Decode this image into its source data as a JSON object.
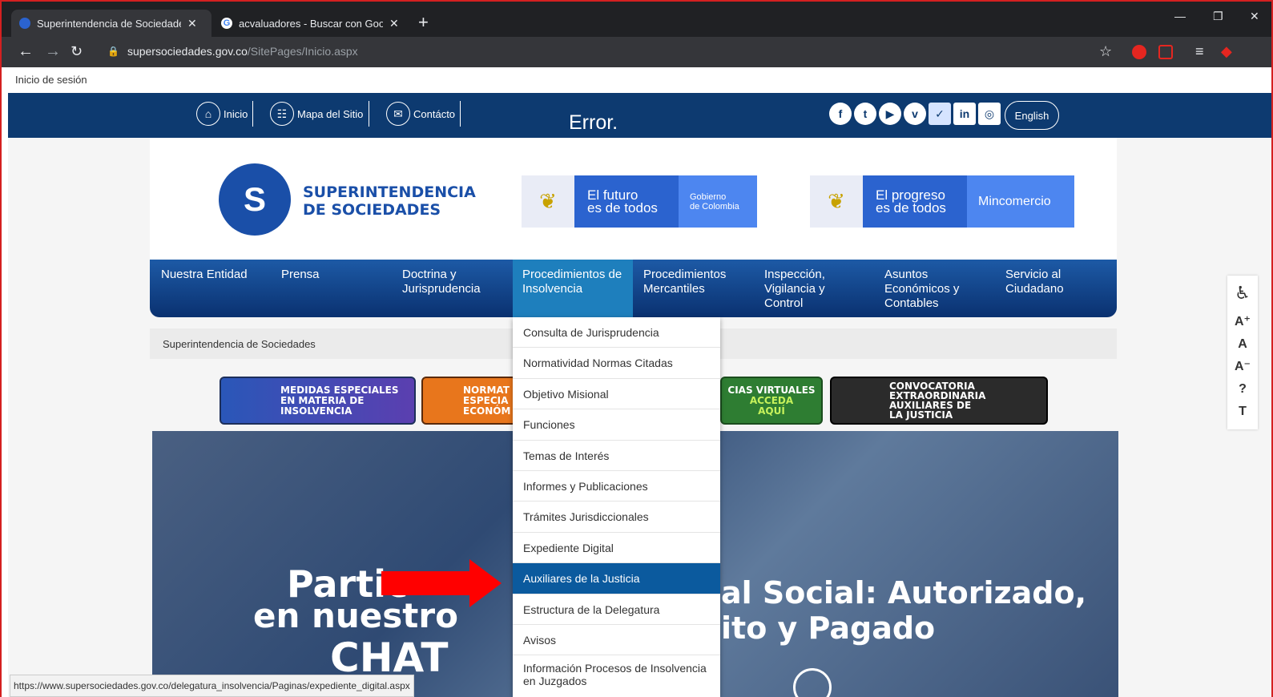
{
  "browser": {
    "tabs": [
      {
        "title": "Superintendencia de Sociedades"
      },
      {
        "title": "acvaluadores - Buscar con Googl"
      }
    ],
    "url_host": "supersociedades.gov.co",
    "url_path": "/SitePages/Inicio.aspx",
    "new_tab": "+",
    "close_glyph": "✕"
  },
  "page": {
    "login": "Inicio de sesión",
    "topnav": [
      {
        "label": "Inicio"
      },
      {
        "label": "Mapa del Sitio"
      },
      {
        "label": "Contácto"
      }
    ],
    "error": "Error.",
    "english": "English",
    "logo_line1": "SUPERINTENDENCIA",
    "logo_line2": "DE SOCIEDADES",
    "gov1": {
      "main1": "El futuro",
      "main2": "es de todos",
      "side1": "Gobierno",
      "side2": "de Colombia"
    },
    "gov2": {
      "main1": "El progreso",
      "main2": "es de todos",
      "side": "Mincomercio"
    },
    "menu": [
      {
        "l1": "Nuestra Entidad",
        "l2": "",
        "l3": ""
      },
      {
        "l1": "Prensa",
        "l2": "",
        "l3": ""
      },
      {
        "l1": "Doctrina y",
        "l2": "Jurisprudencia",
        "l3": ""
      },
      {
        "l1": "Procedimientos de",
        "l2": "Insolvencia",
        "l3": ""
      },
      {
        "l1": "Procedimientos",
        "l2": "Mercantiles",
        "l3": ""
      },
      {
        "l1": "Inspección,",
        "l2": "Vigilancia y",
        "l3": "Control"
      },
      {
        "l1": "Asuntos",
        "l2": "Económicos y",
        "l3": "Contables"
      },
      {
        "l1": "Servicio al",
        "l2": "Ciudadano",
        "l3": ""
      }
    ],
    "breadcrumb": "Superintendencia de Sociedades",
    "banners": {
      "b1": [
        "MEDIDAS ESPECIALES",
        "EN MATERIA DE",
        "INSOLVENCIA"
      ],
      "b2": [
        "NORMAT",
        "ESPECIA",
        "ECONÓM"
      ],
      "b3": [
        "CIAS VIRTUALES",
        "ACCEDA",
        "AQUÍ"
      ],
      "b4": [
        "CONVOCATORIA",
        "EXTRAORDINARIA",
        "AUXILIARES DE",
        "LA JUSTICIA"
      ]
    },
    "hero": {
      "left1": "Partic",
      "left2": "en nuestro",
      "left3": "CHAT",
      "right1": "al Social: Autorizado,",
      "right2": "ito y Pagado"
    },
    "dropdown": [
      "Consulta de Jurisprudencia",
      "Normatividad Normas Citadas",
      "Objetivo Misional",
      "Funciones",
      "Temas de Interés",
      "Informes y Publicaciones",
      "Trámites Jurisdiccionales",
      "Expediente Digital",
      "Auxiliares de la Justicia",
      "Estructura de la Delegatura",
      "Avisos",
      "Información Procesos de Insolvencia",
      "en Juzgados"
    ],
    "accessibility": [
      "A⁺",
      "A",
      "A⁻",
      "?",
      "T"
    ],
    "status_url": "https://www.supersociedades.gov.co/delegatura_insolvencia/Paginas/expediente_digital.aspx"
  },
  "colors": {
    "navy": "#0d3a70",
    "menu_selected": "#1e7fbd",
    "dropdown_highlight": "#0b5a9e",
    "arrow": "#ff0000"
  }
}
